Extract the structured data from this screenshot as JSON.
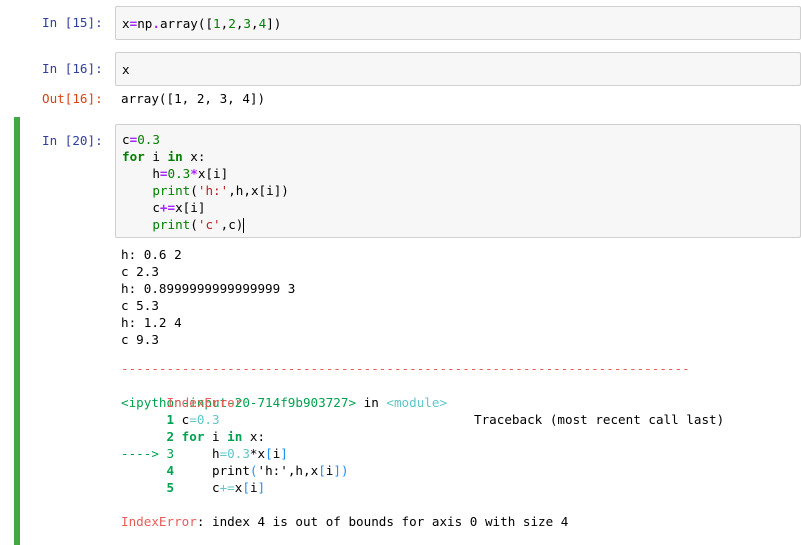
{
  "cells": {
    "c15": {
      "prompt": "In [15]:",
      "code": "x=np.array([1,2,3,4])"
    },
    "c16": {
      "prompt": "In [16]:",
      "code": "x",
      "out_prompt": "Out[16]:",
      "output": "array([1, 2, 3, 4])"
    },
    "c20": {
      "prompt": "In [20]:",
      "code_lines": [
        "c=0.3",
        "for i in x:",
        "    h=0.3*x[i]",
        "    print('h:',h,x[i])",
        "    c+=x[i]",
        "    print('c',c)"
      ],
      "stdout": [
        "h: 0.6 2",
        "c 2.3",
        "h: 0.8999999999999999 3",
        "c 5.3",
        "h: 1.2 4",
        "c 9.3"
      ],
      "traceback": {
        "separator": "---------------------------------------------------------------------------",
        "error_name": "IndexError",
        "header_right": "Traceback (most recent call last)",
        "location": "<ipython-input-20-714f9b903727>",
        "in_word": " in ",
        "module": "<module>",
        "lines": [
          {
            "marker": "      1",
            "code": "c=0.3"
          },
          {
            "marker": "      2",
            "code": "for i in x:"
          },
          {
            "marker": "----> 3",
            "code": "    h=0.3*x[i]"
          },
          {
            "marker": "      4",
            "code": "    print('h:',h,x[i])"
          },
          {
            "marker": "      5",
            "code": "    c+=x[i]"
          }
        ],
        "final_error": "IndexError",
        "final_message": ": index 4 is out of bounds for axis 0 with size 4"
      }
    }
  },
  "colors": {
    "in_prompt": "#303f9f",
    "out_prompt": "#d84315",
    "selected_cell_bar": "#42a942",
    "input_background": "#f7f7f7"
  }
}
